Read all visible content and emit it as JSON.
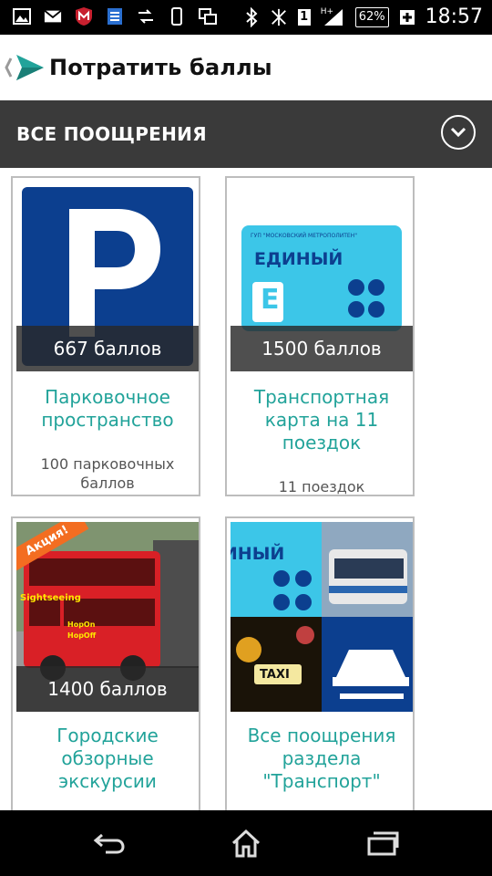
{
  "status_bar": {
    "battery_level": "62%",
    "network_label": "H+",
    "sim_label": "1",
    "time": "18:57",
    "left_icons": [
      "picture-icon",
      "mail-icon",
      "mcafee-icon",
      "app-icon",
      "data-sync-icon",
      "phone-icon",
      "screens-icon"
    ],
    "right_icons": [
      "bluetooth-icon",
      "no-signal-icon",
      "sim-icon",
      "signal-icon",
      "battery-icon",
      "charging-icon"
    ]
  },
  "header": {
    "title": "Потратить баллы",
    "logo_color": "#22a39a"
  },
  "section": {
    "title": "ВСЕ ПООЩРЕНИЯ",
    "toggle_icon": "chevron-down-icon"
  },
  "cards": [
    {
      "points": "667 баллов",
      "title": "Парковочное пространство",
      "subtitle": "100 парковочных баллов",
      "image": "parking-sign"
    },
    {
      "points": "1500 баллов",
      "title": "Транспортная карта на 11 поездок",
      "subtitle": "11 поездок",
      "image": "transport-card"
    },
    {
      "points": "1400 баллов",
      "title": "Городские обзорные экскурсии",
      "subtitle": "",
      "badge": "Акция!",
      "image": "tour-bus"
    },
    {
      "points": "",
      "title": "Все поощрения раздела \"Транспорт\"",
      "subtitle": "",
      "image": "transport-collage"
    }
  ],
  "images": {
    "transport_card": {
      "brand_line": "ГУП \"МОСКОВСКИЙ МЕТРОПОЛИТЕН\"",
      "word": "ЕДИНЫЙ",
      "letter": "Е"
    },
    "taxi_sign": "TAXI",
    "bus_signs": [
      "HopOn",
      "HopOff",
      "Sightseeing"
    ]
  },
  "navigation": {
    "icons": [
      "back-icon",
      "home-icon",
      "recent-apps-icon"
    ]
  },
  "colors": {
    "accent": "#22a39a",
    "section_bg": "#3a3a3a",
    "parking_blue": "#0c3f8f",
    "card_cyan": "#3cc6e8",
    "promo_orange": "#f36d21"
  }
}
